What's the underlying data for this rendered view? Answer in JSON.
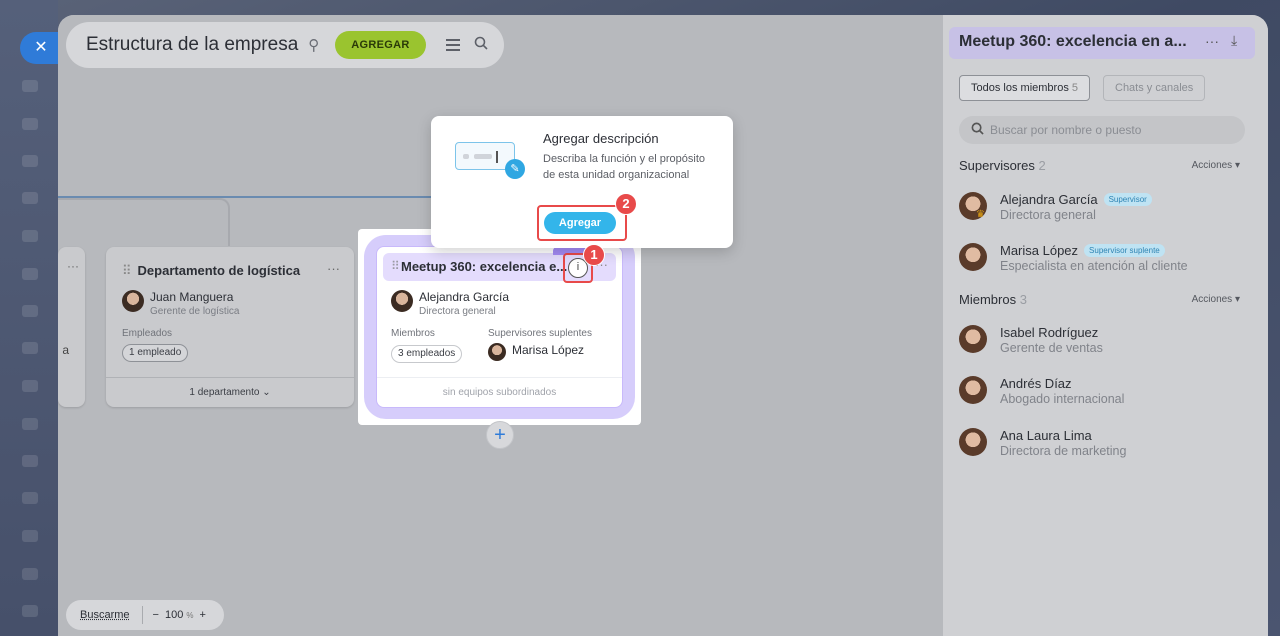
{
  "close_icon": "close-icon",
  "canvas": {
    "title": "Estructura de la empresa",
    "add_label": "AGREGAR",
    "left_card": {
      "partial_text": "a"
    },
    "logistics": {
      "title": "Departamento de logística",
      "head_name": "Juan Manguera",
      "head_role": "Gerente de logística",
      "employees_label": "Empleados",
      "employees_value": "1 empleado",
      "footer": "1 departamento"
    },
    "team": {
      "title": "Meetup 360: excelencia e...",
      "head_name": "Alejandra García",
      "head_role": "Directora general",
      "members_label": "Miembros",
      "members_value": "3 empleados",
      "deputies_label": "Supervisores suplentes",
      "deputy_name": "Marisa López",
      "footer": "sin equipos subordinados",
      "info_glyph": "i"
    },
    "plus": "+",
    "popup": {
      "title": "Agregar descripción",
      "desc": "Describa la función y el propósito de esta unidad organizacional",
      "button": "Agregar"
    },
    "badges": {
      "one": "1",
      "two": "2"
    },
    "bottom": {
      "find": "Buscarme",
      "minus": "−",
      "zoom": "100",
      "pct": "%",
      "plus": "+"
    }
  },
  "panel": {
    "title": "Meetup 360: excelencia en a...",
    "tabs": [
      {
        "label": "Todos los miembros",
        "count": "5"
      },
      {
        "label": "Chats y canales"
      }
    ],
    "search_placeholder": "Buscar por nombre o puesto",
    "supervisors": {
      "title": "Supervisores",
      "count": "2",
      "action": "Acciones",
      "items": [
        {
          "name": "Alejandra García",
          "tag": "Supervisor",
          "role": "Directora general"
        },
        {
          "name": "Marisa López",
          "tag": "Supervisor suplente",
          "role": "Especialista en atención al cliente"
        }
      ]
    },
    "members": {
      "title": "Miembros",
      "count": "3",
      "action": "Acciones",
      "items": [
        {
          "name": "Isabel Rodríguez",
          "role": "Gerente de ventas"
        },
        {
          "name": "Andrés Díaz",
          "role": "Abogado internacional"
        },
        {
          "name": "Ana Laura Lima",
          "role": "Directora de marketing"
        }
      ]
    }
  },
  "colors": {
    "accent_green": "#9ac42f",
    "accent_blue": "#33b5ea",
    "highlight_red": "#e84a4a",
    "team_purple": "#d6cdfb"
  }
}
